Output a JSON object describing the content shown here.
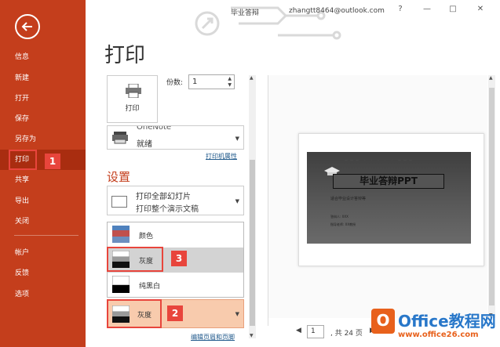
{
  "window": {
    "title": "毕业答辩",
    "account": "zhangtt8464@outlook.com",
    "help": "?",
    "minimize": "—",
    "maximize": "□",
    "close": "✕"
  },
  "sidebar": {
    "items": [
      {
        "label": "信息"
      },
      {
        "label": "新建"
      },
      {
        "label": "打开"
      },
      {
        "label": "保存"
      },
      {
        "label": "另存为"
      },
      {
        "label": "打印"
      },
      {
        "label": "共享"
      },
      {
        "label": "导出"
      },
      {
        "label": "关闭"
      },
      {
        "label": "帐户"
      },
      {
        "label": "反馈"
      },
      {
        "label": "选项"
      }
    ],
    "selected": "打印"
  },
  "callouts": {
    "one": "1",
    "two": "2",
    "three": "3"
  },
  "print": {
    "page_title": "打印",
    "print_button_label": "打印",
    "copies_label": "份数:",
    "copies_value": "1",
    "printer_name": "OneNote",
    "printer_status": "就绪",
    "printer_properties": "打印机属性",
    "settings_title": "设置",
    "range_main": "打印全部幻灯片",
    "range_sub": "打印整个演示文稿",
    "color_options": [
      {
        "label": "颜色"
      },
      {
        "label": "灰度"
      },
      {
        "label": "纯黑白"
      }
    ],
    "color_selected": "灰度",
    "edit_header_footer": "编辑页眉和页脚"
  },
  "preview": {
    "slide_title": "毕业答辩PPT",
    "slide_subtitle": "适合毕业设计答辩等",
    "slide_topline": "——— · · · · · ———",
    "slide_meta_1": "答辩人:  XXX",
    "slide_meta_2": "指导老师:  XX教授",
    "current_page": "1",
    "total_pages": ", 共 24 页",
    "prev": "◀",
    "next": "▶"
  },
  "watermark": {
    "logo": "O",
    "text": "Office教程网",
    "url": "www.office26.com"
  },
  "colors": {
    "brand": "#c43e1c",
    "sidebar_selected": "#a92d10",
    "callout": "#e8453c",
    "selected_option": "#f8cbad"
  }
}
